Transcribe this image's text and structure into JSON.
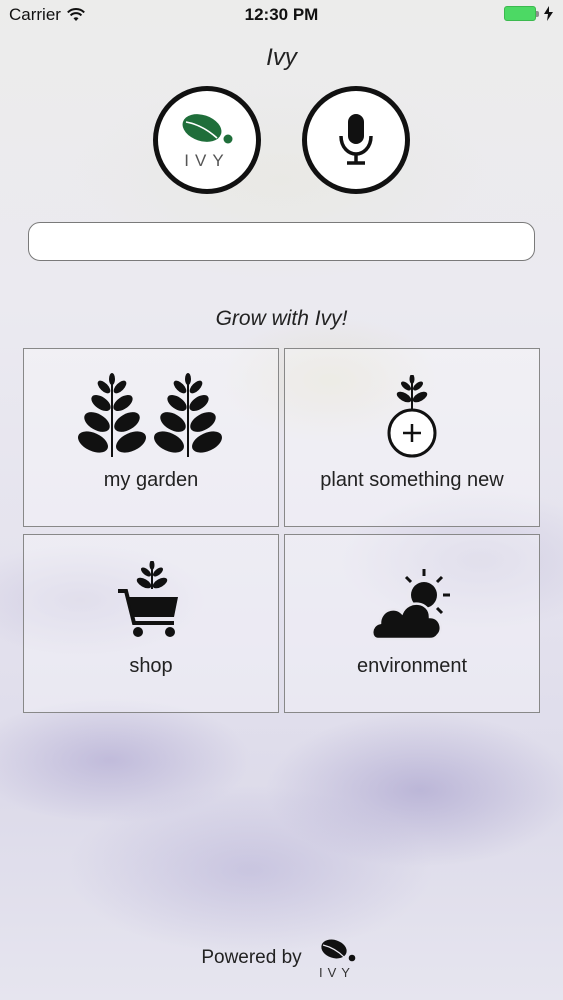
{
  "status_bar": {
    "carrier": "Carrier",
    "time": "12:30 PM",
    "battery_color": "#4cd964"
  },
  "app": {
    "title": "Ivy",
    "logo_text": "IVY",
    "logo_icon": "ivy-leaf-logo",
    "mic_icon": "microphone-icon"
  },
  "search": {
    "value": "",
    "placeholder": ""
  },
  "tagline": "Grow with Ivy!",
  "tiles": [
    {
      "label": "my garden",
      "icon": "two-plants-icon"
    },
    {
      "label": "plant something new",
      "icon": "plant-add-icon"
    },
    {
      "label": "shop",
      "icon": "shopping-cart-plant-icon"
    },
    {
      "label": "environment",
      "icon": "sun-behind-cloud-icon"
    }
  ],
  "footer": {
    "powered_by": "Powered by",
    "logo_text": "IVY"
  },
  "colors": {
    "logo_leaf": "#1f6e3a",
    "border": "#111111"
  }
}
